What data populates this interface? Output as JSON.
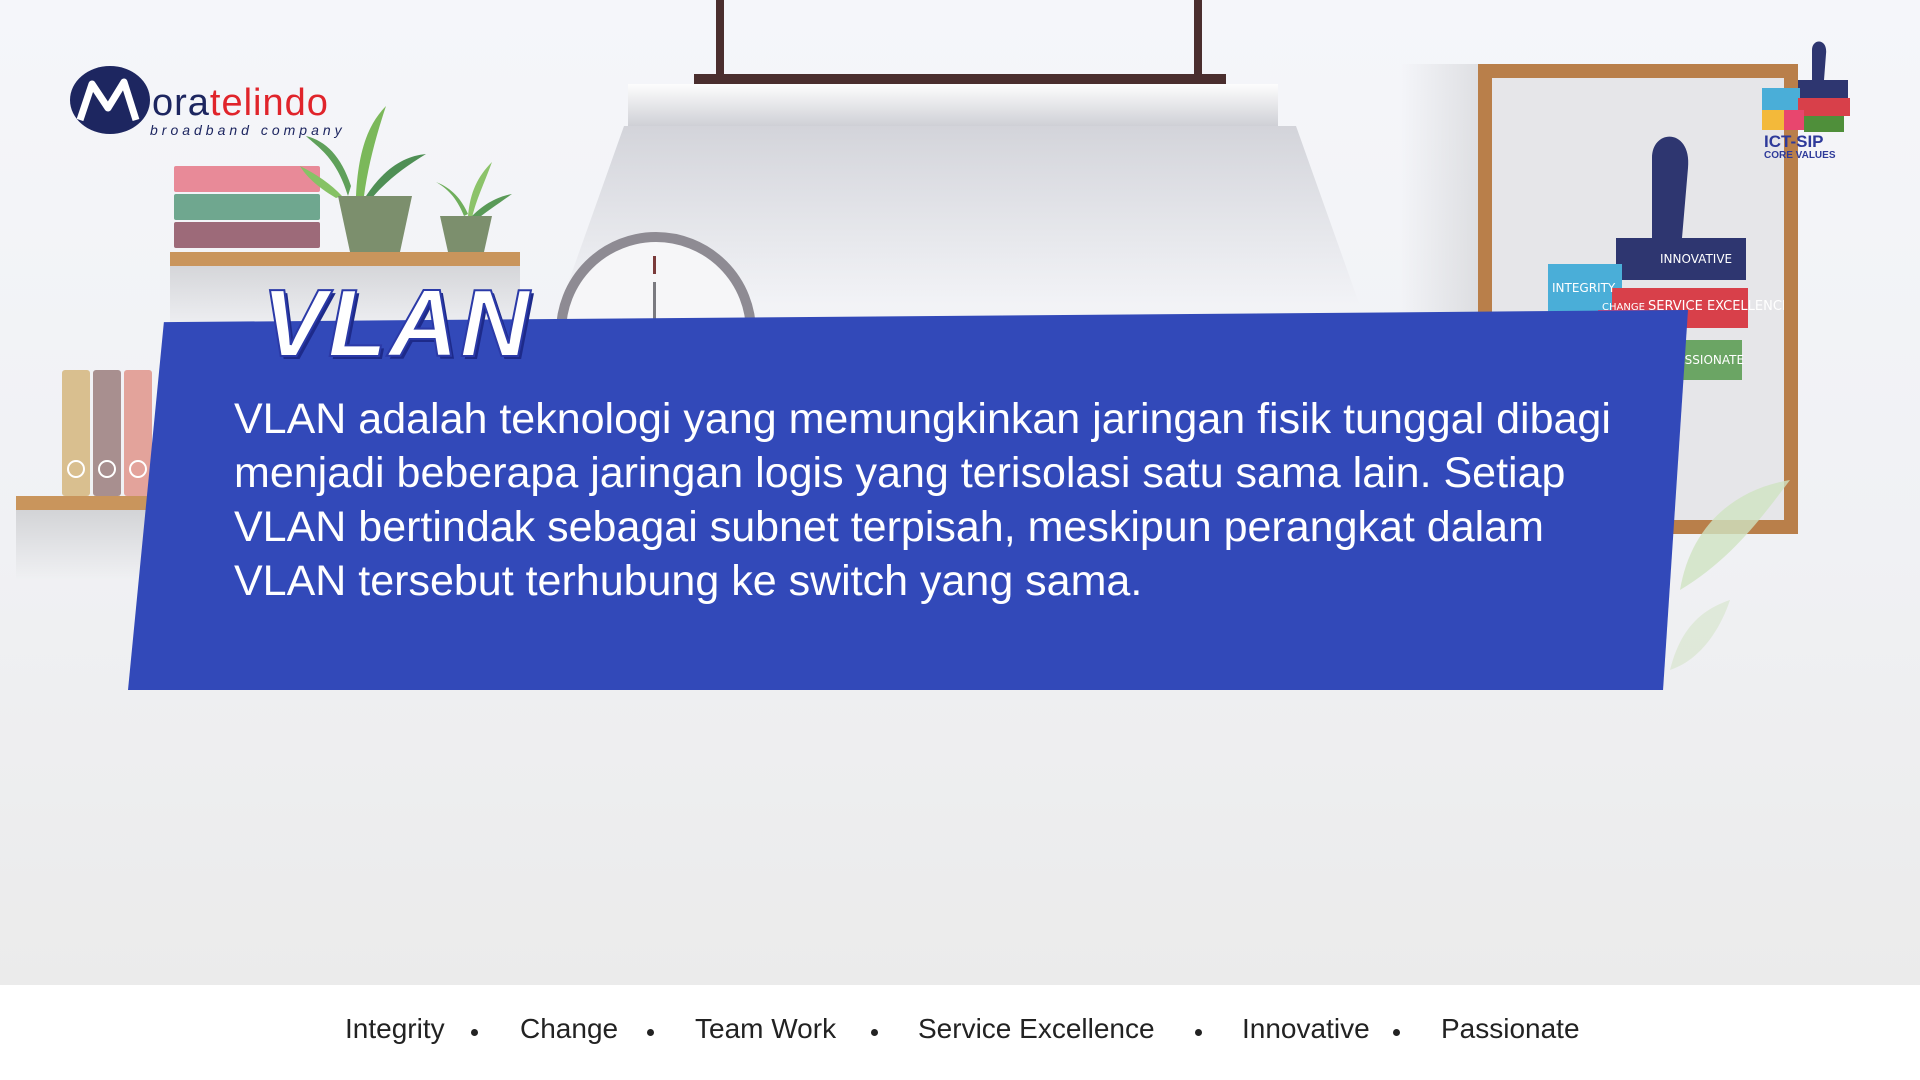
{
  "logo": {
    "brand_prefix": "M",
    "brand_blue": "ora",
    "brand_red": "telindo",
    "tagline": "broadband company"
  },
  "badge": {
    "title": "ICT-SIP",
    "subtitle": "CORE VALUES"
  },
  "poster": {
    "labels": [
      "INNOVATIVE",
      "INTEGRITY",
      "SERVICE EXCELLENCE",
      "CHANGE",
      "PASSIONATE"
    ]
  },
  "slide": {
    "title": "VLAN",
    "body": "VLAN adalah teknologi yang memungkinkan jaringan fisik tunggal dibagi menjadi beberapa jaringan logis yang terisolasi satu sama lain. Setiap VLAN bertindak sebagai subnet terpisah, meskipun perangkat dalam VLAN tersebut terhubung ke switch yang sama."
  },
  "footer": {
    "values": [
      "Integrity",
      "Change",
      "Team Work",
      "Service Excellence",
      "Innovative",
      "Passionate"
    ]
  },
  "colors": {
    "banner": "#3249b9",
    "brand_navy": "#1d2660",
    "brand_red": "#e0242b"
  }
}
